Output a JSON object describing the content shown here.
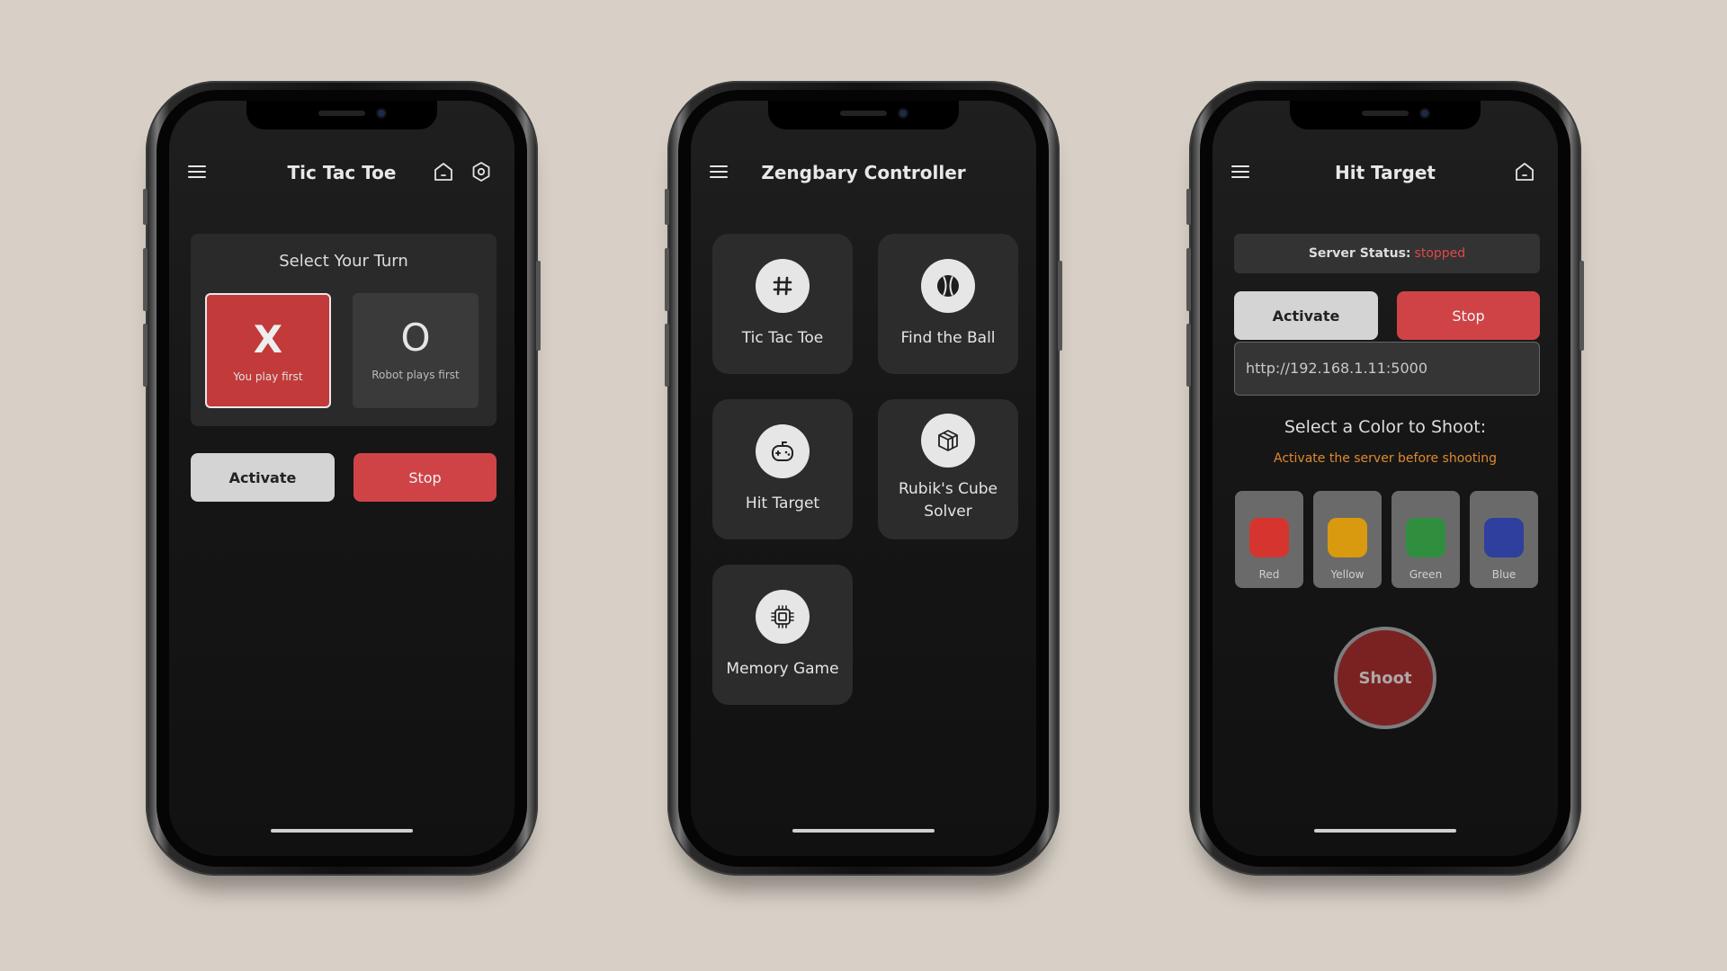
{
  "tictactoe": {
    "title": "Tic Tac Toe",
    "turn_header": "Select Your Turn",
    "options": [
      {
        "symbol": "X",
        "label": "You play first",
        "selected": true
      },
      {
        "symbol": "O",
        "label": "Robot plays first",
        "selected": false
      }
    ],
    "activate_label": "Activate",
    "stop_label": "Stop"
  },
  "controller": {
    "title": "Zengbary Controller",
    "tiles": [
      {
        "label": "Tic Tac Toe",
        "icon": "hash-icon"
      },
      {
        "label": "Find the Ball",
        "icon": "ball-icon"
      },
      {
        "label": "Hit Target",
        "icon": "gamepad-icon"
      },
      {
        "label": "Rubik's Cube Solver",
        "line1": "Rubik's Cube",
        "line2": "Solver",
        "icon": "cube-icon"
      },
      {
        "label": "Memory Game",
        "icon": "chip-icon"
      }
    ]
  },
  "hittarget": {
    "title": "Hit Target",
    "server_status_label": "Server Status:",
    "server_status_value": "stopped",
    "activate_label": "Activate",
    "stop_label": "Stop",
    "url_value": "http://192.168.1.11:5000",
    "pick_title": "Select a Color to Shoot:",
    "pick_hint": "Activate the server before shooting",
    "colors": [
      {
        "name": "Red",
        "hex": "#d6352f"
      },
      {
        "name": "Yellow",
        "hex": "#d99a10"
      },
      {
        "name": "Green",
        "hex": "#2f8f3e"
      },
      {
        "name": "Blue",
        "hex": "#2e3f9e"
      }
    ],
    "shoot_label": "Shoot"
  },
  "colors": {
    "background": "#d8d0c6",
    "accent_red": "#cf4346",
    "selected_red": "#c23a3a",
    "warning_orange": "#e08a2c"
  }
}
